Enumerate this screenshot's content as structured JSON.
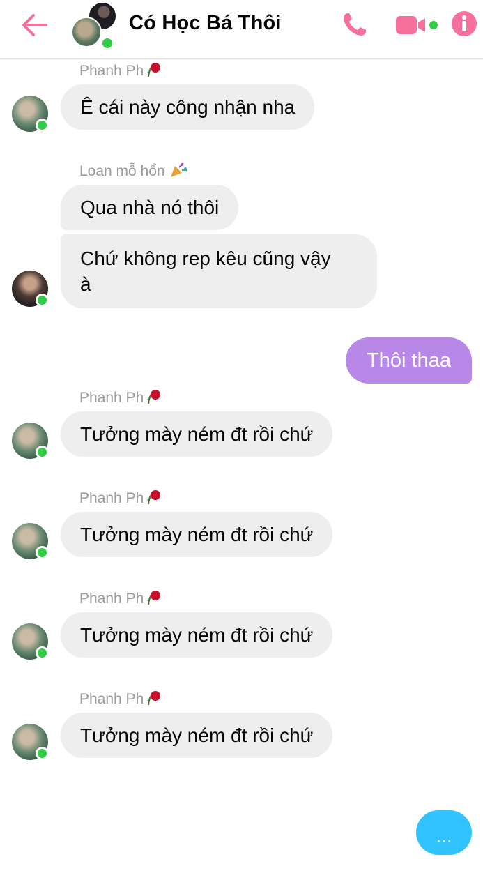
{
  "header": {
    "title": "Có Học Bá Thôi",
    "icons": [
      "back-arrow-icon",
      "phone-icon",
      "video-camera-icon",
      "info-icon"
    ],
    "accent_color": "#f7709c",
    "online_color": "#31cc46"
  },
  "messages": [
    {
      "sender": "Phanh Ph",
      "sender_emoji": "wilted-rose-icon",
      "text": "Ê cái này công nhận nha"
    },
    {
      "sender": "Loan mỗ hổn",
      "sender_emoji": "party-popper-icon",
      "text": "Qua nhà nó thôi"
    },
    {
      "text": "Chứ không rep kêu cũng vậy",
      "text2": "à"
    },
    {
      "text": "Thôi thaa",
      "own": true
    },
    {
      "sender": "Phanh Ph",
      "sender_emoji": "wilted-rose-icon",
      "text": "Tưởng mày ném đt rồi chứ"
    },
    {
      "sender": "Phanh Ph",
      "sender_emoji": "wilted-rose-icon",
      "text": "Tưởng mày ném đt rồi chứ"
    },
    {
      "sender": "Phanh Ph",
      "sender_emoji": "wilted-rose-icon",
      "text": "Tưởng mày ném đt rồi chứ"
    },
    {
      "sender": "Phanh Ph",
      "sender_emoji": "wilted-rose-icon",
      "text": "Tưởng mày ném đt rồi chứ"
    }
  ],
  "own_bubble_color": "#b887e8",
  "typing_indicator": {
    "text": "...",
    "color": "#30c3ff"
  }
}
